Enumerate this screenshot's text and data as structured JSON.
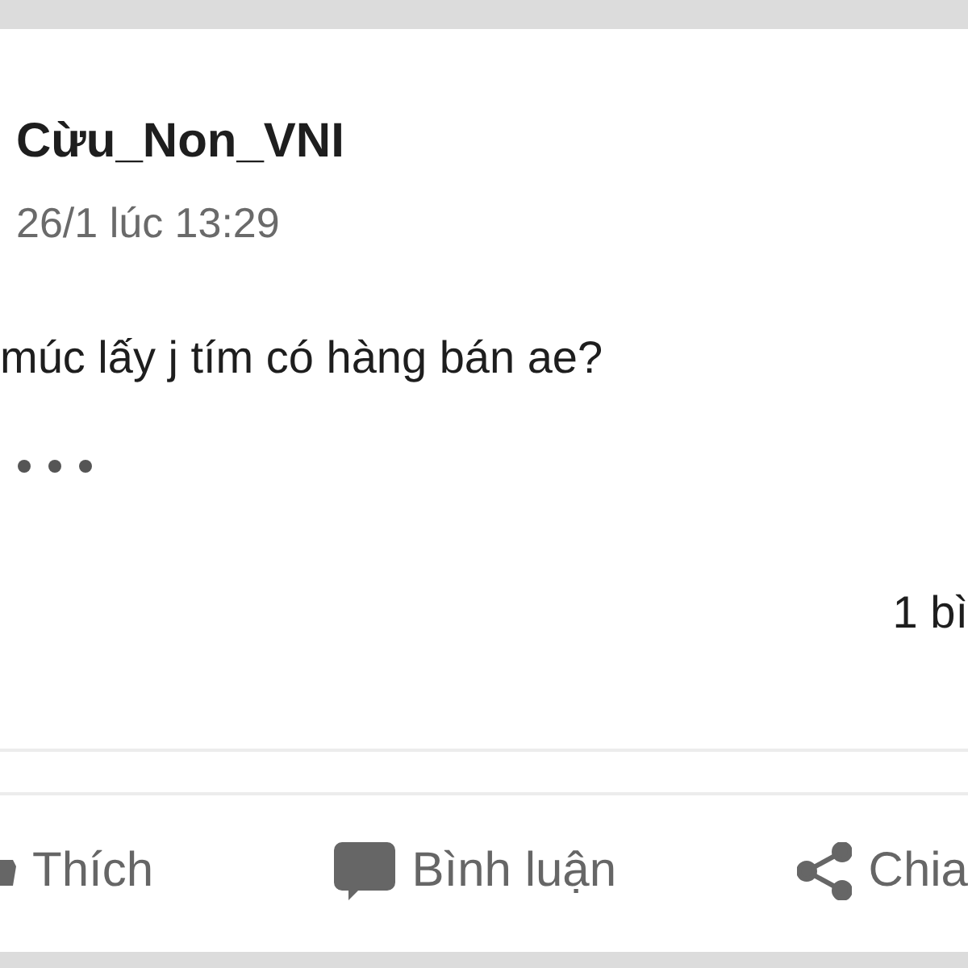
{
  "post": {
    "author": "Cừu_Non_VNI",
    "timestamp": "26/1 lúc 13:29",
    "text": "múc lấy j tím có hàng bán ae?",
    "stats": "1 bì"
  },
  "actions": [
    {
      "kind": "like",
      "label": "Thích"
    },
    {
      "kind": "comment",
      "label": "Bình luận"
    },
    {
      "kind": "share",
      "label": "Chia"
    }
  ]
}
